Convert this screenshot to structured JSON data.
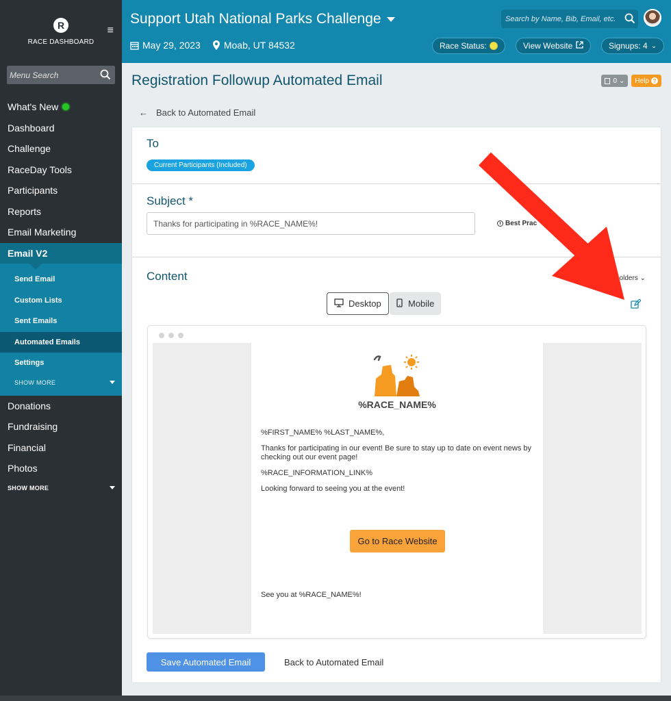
{
  "sidebar": {
    "logo_letter": "R",
    "logo_text": "RACE DASHBOARD",
    "menu_search_placeholder": "Menu Search",
    "items": [
      {
        "label": "What's New"
      },
      {
        "label": "Dashboard"
      },
      {
        "label": "Challenge"
      },
      {
        "label": "RaceDay Tools"
      },
      {
        "label": "Participants"
      },
      {
        "label": "Reports"
      },
      {
        "label": "Email Marketing"
      },
      {
        "label": "Email V2"
      }
    ],
    "subitems": [
      {
        "label": "Send Email"
      },
      {
        "label": "Custom Lists"
      },
      {
        "label": "Sent Emails"
      },
      {
        "label": "Automated Emails"
      },
      {
        "label": "Settings"
      }
    ],
    "sub_show_more": "SHOW  MORE",
    "items_after": [
      {
        "label": "Donations"
      },
      {
        "label": "Fundraising"
      },
      {
        "label": "Financial"
      },
      {
        "label": "Photos"
      }
    ],
    "show_more": "SHOW MORE"
  },
  "header": {
    "title": "Support Utah National Parks Challenge",
    "date": "May 29, 2023",
    "location": "Moab, UT 84532",
    "search_placeholder": "Search by Name, Bib, Email, etc.",
    "race_status_label": "Race Status:",
    "view_website_label": "View Website",
    "signups_label": "Signups: 4"
  },
  "main": {
    "page_title": "Registration Followup Automated Email",
    "count_badge": "0",
    "help_label": "Help",
    "back_link": "Back to Automated Email",
    "to_label": "To",
    "to_tag": "Current Participants (Included)",
    "subject_label": "Subject *",
    "subject_value": "Thanks for participating in %RACE_NAME%!",
    "best_practices": "Best Prac",
    "content_label": "Content",
    "placeholders": "holders",
    "desktop_label": "Desktop",
    "mobile_label": "Mobile",
    "email": {
      "race_name": "%RACE_NAME%",
      "greeting": "%FIRST_NAME% %LAST_NAME%,",
      "body1": "Thanks for participating in our event! Be sure to stay up to date on event news by checking out our event page!",
      "info_link": "%RACE_INFORMATION_LINK%",
      "body2": "Looking forward to seeing you at the event!",
      "cta_label": "Go to Race Website",
      "signoff": "See you at %RACE_NAME%!"
    },
    "save_label": "Save Automated Email",
    "back_bottom": "Back to Automated Email"
  },
  "colors": {
    "header": "#1387ad",
    "sidebar": "#2b3035",
    "subnav": "#1181a4",
    "accent_orange": "#f9a33a",
    "save_blue": "#4f92e5",
    "annotation_red": "#ff2a1a"
  }
}
